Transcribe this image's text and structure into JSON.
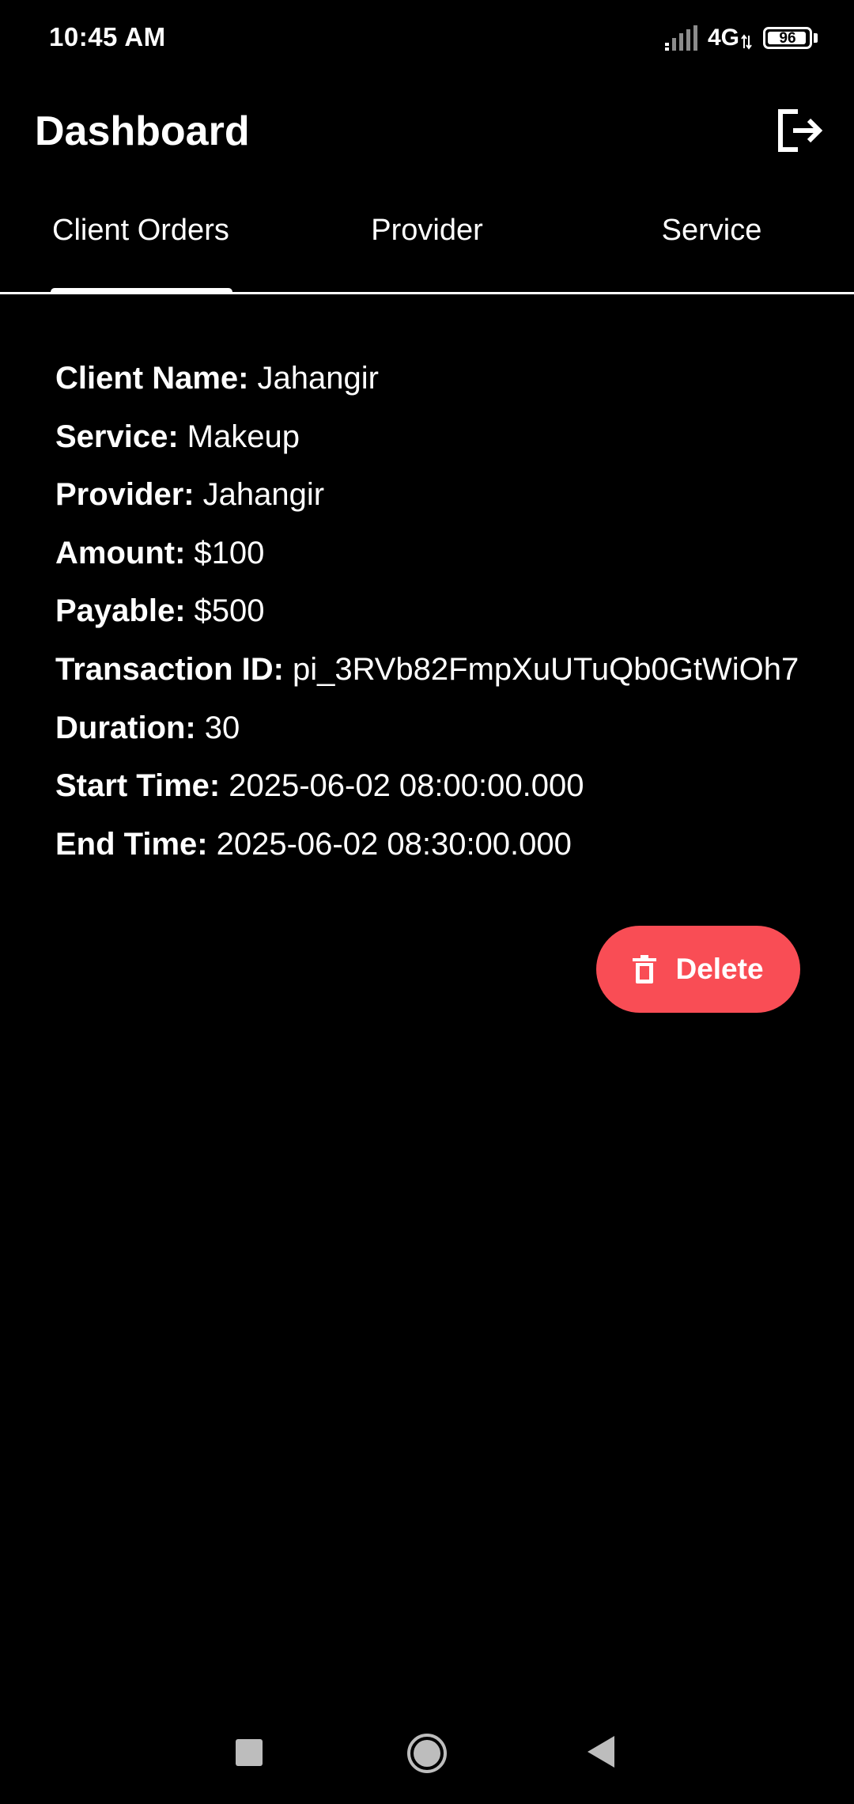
{
  "status_bar": {
    "time": "10:45 AM",
    "network": "4G",
    "battery": "96",
    "battery_level": 0.96,
    "icons": [
      "signal-icon",
      "network-arrows-icon",
      "battery-icon"
    ]
  },
  "header": {
    "title": "Dashboard",
    "logout_icon": "logout-icon"
  },
  "tabs": [
    {
      "label": "Client Orders",
      "active": true
    },
    {
      "label": "Provider",
      "active": false
    },
    {
      "label": "Service",
      "active": false
    }
  ],
  "order": {
    "fields": [
      {
        "label": "Client Name:",
        "value": "Jahangir"
      },
      {
        "label": "Service:",
        "value": "Makeup"
      },
      {
        "label": "Provider:",
        "value": "Jahangir"
      },
      {
        "label": "Amount:",
        "value": "$100"
      },
      {
        "label": "Payable:",
        "value": "$500"
      },
      {
        "label": "Transaction ID:",
        "value": "pi_3RVb82FmpXuUTuQb0GtWiOh7"
      },
      {
        "label": "Duration:",
        "value": "30"
      },
      {
        "label": "Start Time:",
        "value": "2025-06-02 08:00:00.000"
      },
      {
        "label": "End Time:",
        "value": "2025-06-02 08:30:00.000"
      }
    ],
    "delete_label": "Delete",
    "delete_icon": "trash-icon"
  },
  "colors": {
    "background": "#000000",
    "text": "#ffffff",
    "delete_button": "#f94d55"
  },
  "nav_bar": {
    "icons": [
      "recent-apps-icon",
      "home-icon",
      "back-icon"
    ]
  }
}
